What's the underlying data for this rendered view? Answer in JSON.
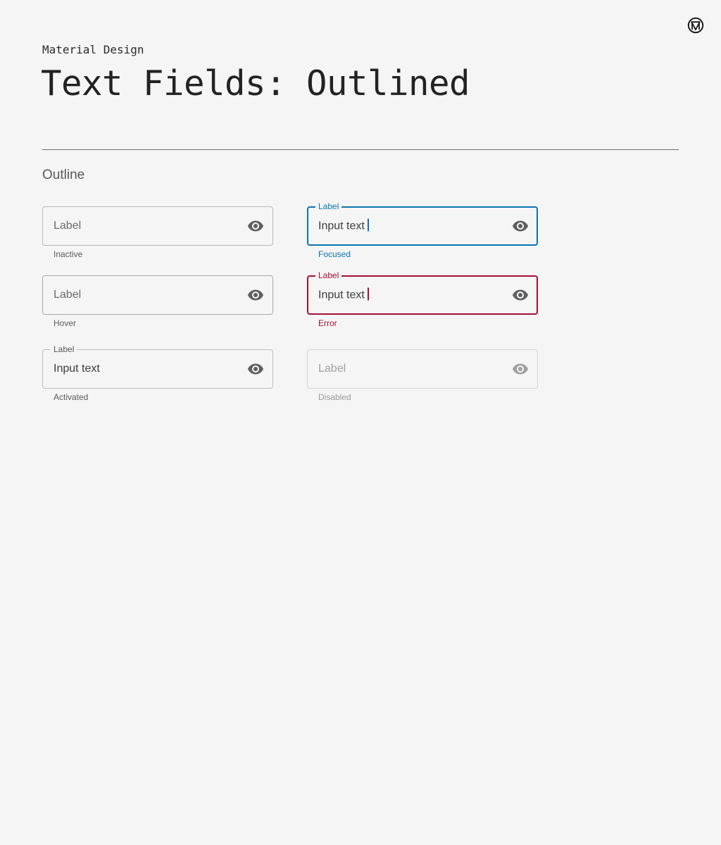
{
  "header": {
    "eyebrow": "Material Design",
    "title": "Text Fields: Outlined",
    "logo_icon": "material-logo-icon"
  },
  "section": {
    "title": "Outline"
  },
  "fields": {
    "inactive": {
      "placeholder": "Label",
      "helper": "Inactive",
      "trailing_icon": "eye-icon"
    },
    "focused": {
      "label": "Label",
      "value": "Input text",
      "helper": "Focused",
      "trailing_icon": "eye-icon"
    },
    "hover": {
      "placeholder": "Label",
      "helper": "Hover",
      "trailing_icon": "eye-icon"
    },
    "error": {
      "label": "Label",
      "value": "Input text",
      "helper": "Error",
      "trailing_icon": "eye-icon"
    },
    "activated": {
      "label": "Label",
      "value": "Input text",
      "helper": "Activated",
      "trailing_icon": "eye-icon"
    },
    "disabled": {
      "placeholder": "Label",
      "helper": "Disabled",
      "trailing_icon": "eye-icon"
    }
  },
  "colors": {
    "background": "#f5f5f5",
    "focused": "#0a74b3",
    "error": "#a31133",
    "icon": "#5f5f5f",
    "icon_disabled": "#a0a0a0"
  }
}
